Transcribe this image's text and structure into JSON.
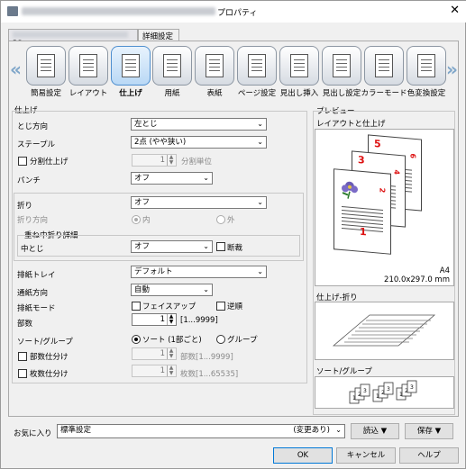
{
  "window": {
    "title_suffix": "プロパティ",
    "close_glyph": "✕"
  },
  "tabs": [
    {
      "label": "PS"
    },
    {
      "label": "詳細設定"
    }
  ],
  "iconbar": {
    "items": [
      {
        "label": "簡易設定",
        "icon": "quick-setup-icon"
      },
      {
        "label": "レイアウト",
        "icon": "layout-icon"
      },
      {
        "label": "仕上げ",
        "icon": "finishing-icon",
        "active": true
      },
      {
        "label": "用紙",
        "icon": "paper-icon"
      },
      {
        "label": "表紙",
        "icon": "cover-icon"
      },
      {
        "label": "ページ設定",
        "icon": "page-setup-icon"
      },
      {
        "label": "見出し挿入",
        "icon": "tab-insert-icon"
      },
      {
        "label": "見出し設定",
        "icon": "tab-setting-icon"
      },
      {
        "label": "カラーモード",
        "icon": "color-mode-icon"
      },
      {
        "label": "色変換設定",
        "icon": "color-conversion-icon"
      }
    ]
  },
  "finishing": {
    "section_title": "仕上げ",
    "binding_label": "とじ方向",
    "binding_value": "左とじ",
    "staple_label": "ステープル",
    "staple_value": "2点 (やや狭い)",
    "split_label": "分割仕上げ",
    "split_value": "1",
    "split_unit": "分割単位",
    "punch_label": "パンチ",
    "punch_value": "オフ",
    "fold_label": "折り",
    "fold_value": "オフ",
    "fold_direction_label": "折り方向",
    "fold_in": "内",
    "fold_out": "外",
    "stack_fold_title": "重ね中折り詳細",
    "center_fold_label": "中とじ",
    "center_fold_value": "オフ",
    "trim_label": "断裁",
    "tray_label": "排紙トレイ",
    "tray_value": "デフォルト",
    "feed_direction_label": "通紙方向",
    "feed_direction_value": "自動",
    "output_mode_label": "排紙モード",
    "face_up_label": "フェイスアップ",
    "reverse_label": "逆順",
    "copies_label": "部数",
    "copies_value": "1",
    "copies_range": "[1...9999]",
    "sort_label": "ソート/グループ",
    "sort_option": "ソート (1部ごと)",
    "group_option": "グループ",
    "set_split_label": "部数仕分け",
    "set_split_value": "1",
    "set_split_hint": "部数[1...9999]",
    "sheet_split_label": "枚数仕分け",
    "sheet_split_value": "1",
    "sheet_split_hint": "枚数[1...65535]"
  },
  "preview": {
    "section_title": "プレビュー",
    "layout_title": "レイアウトと仕上げ",
    "page_numbers": [
      "1",
      "2",
      "3",
      "4",
      "5",
      "6"
    ],
    "paper_size": "A4",
    "paper_dims": "210.0x297.0 mm",
    "fold_title": "仕上げ-折り",
    "sort_title": "ソート/グループ"
  },
  "footer": {
    "favorite_label": "お気に入り",
    "favorite_value": "標準設定",
    "favorite_changed": "(変更あり)",
    "load_label": "読込",
    "save_label": "保存",
    "ok_label": "OK",
    "cancel_label": "キャンセル",
    "help_label": "ヘルプ"
  }
}
